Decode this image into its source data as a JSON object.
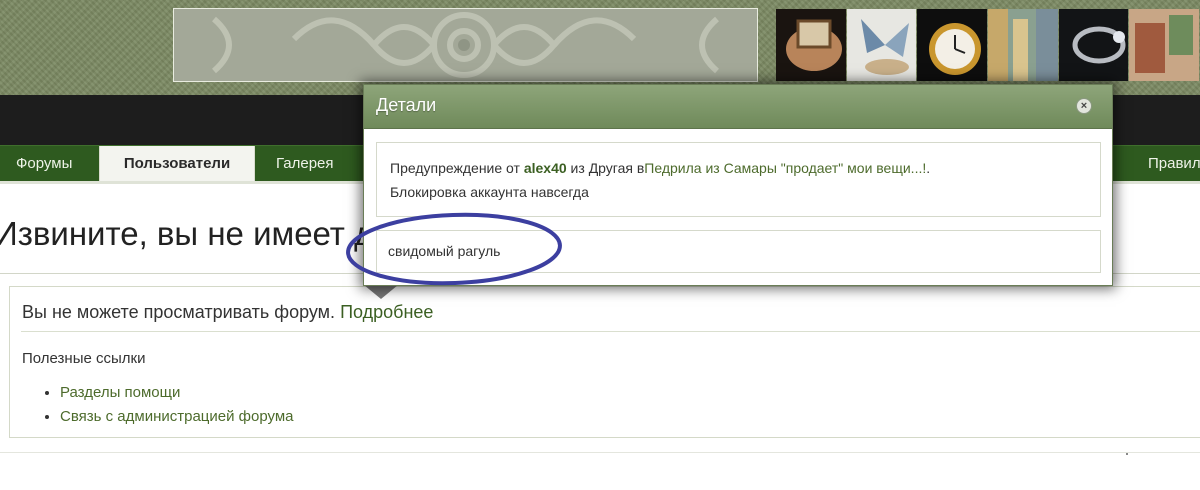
{
  "nav": {
    "tabs": [
      {
        "label": "Форумы"
      },
      {
        "label": "Пользователи"
      },
      {
        "label": "Галерея"
      },
      {
        "label": "Правил"
      }
    ],
    "active_index": 1
  },
  "page": {
    "title": "Извините, вы не имеет д",
    "message": "Вы не можете просматривать форум.",
    "more_link": "Подробнее",
    "links_heading": "Полезные ссылки",
    "links": [
      "Разделы помощи",
      "Связь с администрацией форума"
    ]
  },
  "modal": {
    "title": "Детали",
    "close_symbol": "×",
    "detail": {
      "prefix": "Предупреждение от",
      "user": "alex40",
      "in_word": "из",
      "forum": "Другая",
      "in_word2": "в",
      "topic": "Педрила из Самары \"продает\" мои вещи...!",
      "dot": ".",
      "line2": "Блокировка аккаунта навсегда"
    },
    "reason": "свидомый рагуль"
  },
  "colors": {
    "header_bg": "#7c8a63",
    "nav_bg": "#2e5a1f",
    "modal_header": "#7f9a6a",
    "link": "#4d6b2c",
    "annotation": "#3c3fa0"
  },
  "icons": {
    "close": "close-icon"
  }
}
